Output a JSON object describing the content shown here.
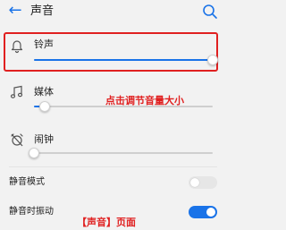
{
  "header": {
    "back_glyph": "←",
    "title": "声音",
    "search_icon": "search-icon"
  },
  "rows": [
    {
      "label": "铃声",
      "icon": "bell-icon",
      "volume": 1.0
    },
    {
      "label": "媒体",
      "icon": "music-note-icon",
      "volume": 0.06
    },
    {
      "label": "闹钟",
      "icon": "alarm-off-icon",
      "volume": 0.0
    }
  ],
  "toggles": [
    {
      "label": "静音模式",
      "on": false
    },
    {
      "label": "静音时振动",
      "on": true
    }
  ],
  "annotations": {
    "highlight_note": "点击调节音量大小",
    "caption": "【声音】页面"
  },
  "colors": {
    "accent": "#1a73e8",
    "annotation": "#e02020"
  }
}
